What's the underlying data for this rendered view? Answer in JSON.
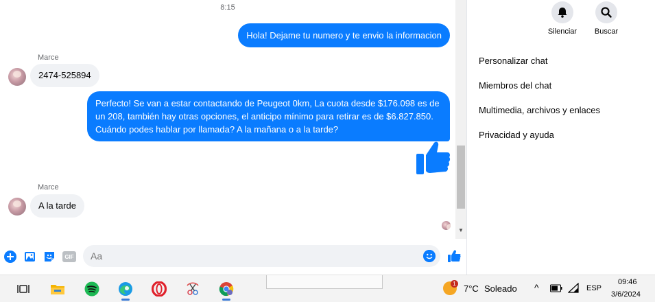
{
  "chat": {
    "timestamp": "8:15",
    "messages": [
      {
        "dir": "out",
        "text": "Hola! Dejame tu numero y te envio la informacion"
      },
      {
        "dir": "in",
        "sender": "Marce",
        "text": "2474-525894"
      },
      {
        "dir": "out",
        "text": "Perfecto!  Se van a estar contactando de Peugeot 0km, La cuota desde $176.098 es de un 208, también hay otras opciones, el anticipo mínimo para retirar es de $6.827.850. Cuándo podes hablar por llamada? A la mañana o a la tarde?"
      },
      {
        "dir": "out",
        "sticker": "thumbs-up"
      },
      {
        "dir": "in",
        "sender": "Marce",
        "text": "A la tarde"
      }
    ]
  },
  "composer": {
    "placeholder": "Aa",
    "icons": [
      "plus-circle-icon",
      "image-icon",
      "sticker-icon",
      "gif-icon",
      "emoji-icon",
      "thumbs-up-icon"
    ],
    "gif_label": "GIF"
  },
  "panel": {
    "actions": [
      {
        "label": "Silenciar",
        "icon": "bell-icon"
      },
      {
        "label": "Buscar",
        "icon": "search-icon"
      }
    ],
    "items": [
      "Personalizar chat",
      "Miembros del chat",
      "Multimedia, archivos y enlaces",
      "Privacidad y ayuda"
    ]
  },
  "taskbar": {
    "apps": [
      "task-view-icon",
      "file-explorer-icon",
      "spotify-icon",
      "edge-icon",
      "opera-icon",
      "snipping-tool-icon",
      "chrome-icon"
    ],
    "weather": {
      "temp": "7°C",
      "condition": "Soleado",
      "badge": "1"
    },
    "language": "ESP",
    "time": "09:46",
    "date": "3/6/2024"
  },
  "colors": {
    "accent": "#0a7cff",
    "bubble_in": "#f0f2f5",
    "panel_btn": "#e4e6eb"
  }
}
